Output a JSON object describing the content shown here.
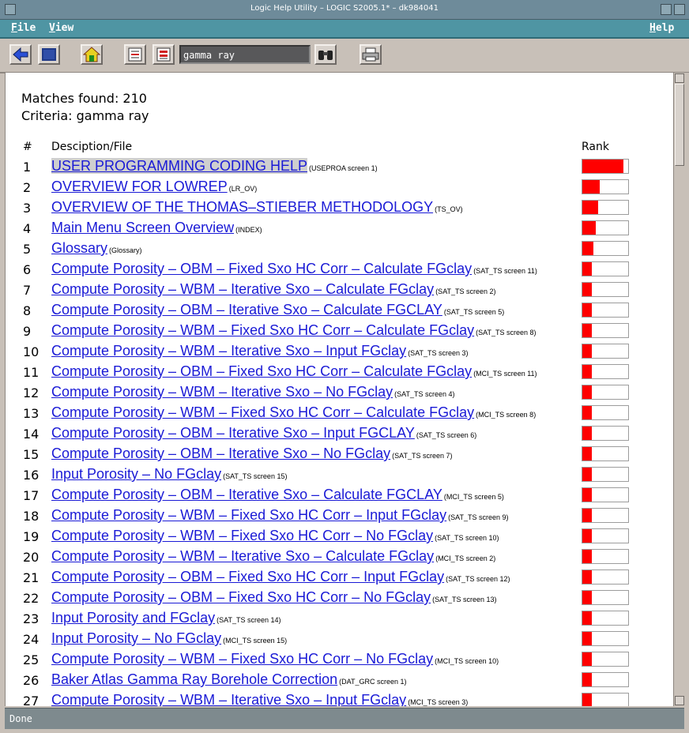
{
  "window": {
    "title": "Logic Help Utility – LOGIC S2005.1* – dk984041"
  },
  "menu": {
    "file": "File",
    "view": "View",
    "help": "Help"
  },
  "toolbar": {
    "search_value": "gamma ray"
  },
  "summary": {
    "matches": "Matches found: 210",
    "criteria": "Criteria: gamma ray"
  },
  "columns": {
    "num": "#",
    "desc": "Desciption/File",
    "rank": "Rank"
  },
  "colors": {
    "link": "#1a1ad6",
    "rank_fill": "#ff0000",
    "menubar": "#4f95a3"
  },
  "results": [
    {
      "num": "1",
      "title": "USER PROGRAMMING CODING HELP",
      "file": "(USEPROA screen 1)",
      "rank": 0.9
    },
    {
      "num": "2",
      "title": "OVERVIEW FOR LOWREP",
      "file": "(LR_OV)",
      "rank": 0.38
    },
    {
      "num": "3",
      "title": "OVERVIEW OF THE THOMAS–STIEBER METHODOLOGY",
      "file": "(TS_OV)",
      "rank": 0.35
    },
    {
      "num": "4",
      "title": "Main Menu Screen Overview",
      "file": "(INDEX)",
      "rank": 0.3
    },
    {
      "num": "5",
      "title": "Glossary",
      "file": "(Glossary)",
      "rank": 0.24
    },
    {
      "num": "6",
      "title": "Compute Porosity – OBM – Fixed Sxo HC Corr – Calculate FGclay",
      "file": "(SAT_TS screen 11)",
      "rank": 0.2
    },
    {
      "num": "7",
      "title": "Compute Porosity – WBM – Iterative Sxo – Calculate FGclay",
      "file": "(SAT_TS screen 2)",
      "rank": 0.2
    },
    {
      "num": "8",
      "title": "Compute Porosity – OBM – Iterative Sxo – Calculate FGCLAY",
      "file": "(SAT_TS screen 5)",
      "rank": 0.2
    },
    {
      "num": "9",
      "title": "Compute Porosity – WBM – Fixed Sxo HC Corr – Calculate FGclay",
      "file": "(SAT_TS screen 8)",
      "rank": 0.2
    },
    {
      "num": "10",
      "title": "Compute Porosity – WBM – Iterative Sxo – Input FGclay",
      "file": "(SAT_TS screen 3)",
      "rank": 0.2
    },
    {
      "num": "11",
      "title": "Compute Porosity – OBM – Fixed Sxo HC Corr – Calculate FGclay",
      "file": "(MCI_TS screen 11)",
      "rank": 0.2
    },
    {
      "num": "12",
      "title": "Compute Porosity – WBM – Iterative Sxo – No FGclay",
      "file": "(SAT_TS screen 4)",
      "rank": 0.2
    },
    {
      "num": "13",
      "title": "Compute Porosity – WBM – Fixed Sxo HC Corr – Calculate FGclay",
      "file": "(MCI_TS screen 8)",
      "rank": 0.2
    },
    {
      "num": "14",
      "title": "Compute Porosity – OBM – Iterative Sxo – Input FGCLAY",
      "file": "(SAT_TS screen 6)",
      "rank": 0.2
    },
    {
      "num": "15",
      "title": "Compute Porosity – OBM – Iterative Sxo – No FGclay",
      "file": "(SAT_TS screen 7)",
      "rank": 0.2
    },
    {
      "num": "16",
      "title": "Input Porosity – No FGclay",
      "file": "(SAT_TS screen 15)",
      "rank": 0.2
    },
    {
      "num": "17",
      "title": "Compute Porosity – OBM – Iterative Sxo – Calculate FGCLAY",
      "file": "(MCI_TS screen 5)",
      "rank": 0.2
    },
    {
      "num": "18",
      "title": "Compute Porosity – WBM – Fixed Sxo HC Corr – Input FGclay",
      "file": "(SAT_TS screen 9)",
      "rank": 0.2
    },
    {
      "num": "19",
      "title": "Compute Porosity – WBM – Fixed Sxo HC Corr – No FGclay",
      "file": "(SAT_TS screen 10)",
      "rank": 0.2
    },
    {
      "num": "20",
      "title": "Compute Porosity – WBM – Iterative Sxo – Calculate FGclay",
      "file": "(MCI_TS screen 2)",
      "rank": 0.2
    },
    {
      "num": "21",
      "title": "Compute Porosity – OBM – Fixed Sxo HC Corr – Input FGclay",
      "file": "(SAT_TS screen 12)",
      "rank": 0.2
    },
    {
      "num": "22",
      "title": "Compute Porosity – OBM – Fixed Sxo HC Corr – No FGclay",
      "file": "(SAT_TS screen 13)",
      "rank": 0.2
    },
    {
      "num": "23",
      "title": "Input Porosity and FGclay",
      "file": "(SAT_TS screen 14)",
      "rank": 0.2
    },
    {
      "num": "24",
      "title": "Input Porosity – No FGclay",
      "file": "(MCI_TS screen 15)",
      "rank": 0.2
    },
    {
      "num": "25",
      "title": "Compute Porosity – WBM – Fixed Sxo HC Corr – No FGclay",
      "file": "(MCI_TS screen 10)",
      "rank": 0.2
    },
    {
      "num": "26",
      "title": "Baker Atlas Gamma Ray Borehole Correction",
      "file": "(DAT_GRC screen 1)",
      "rank": 0.2
    },
    {
      "num": "27",
      "title": "Compute Porosity – WBM – Iterative Sxo – Input FGclay",
      "file": "(MCI_TS screen 3)",
      "rank": 0.2
    }
  ],
  "status": {
    "text": "Done"
  }
}
